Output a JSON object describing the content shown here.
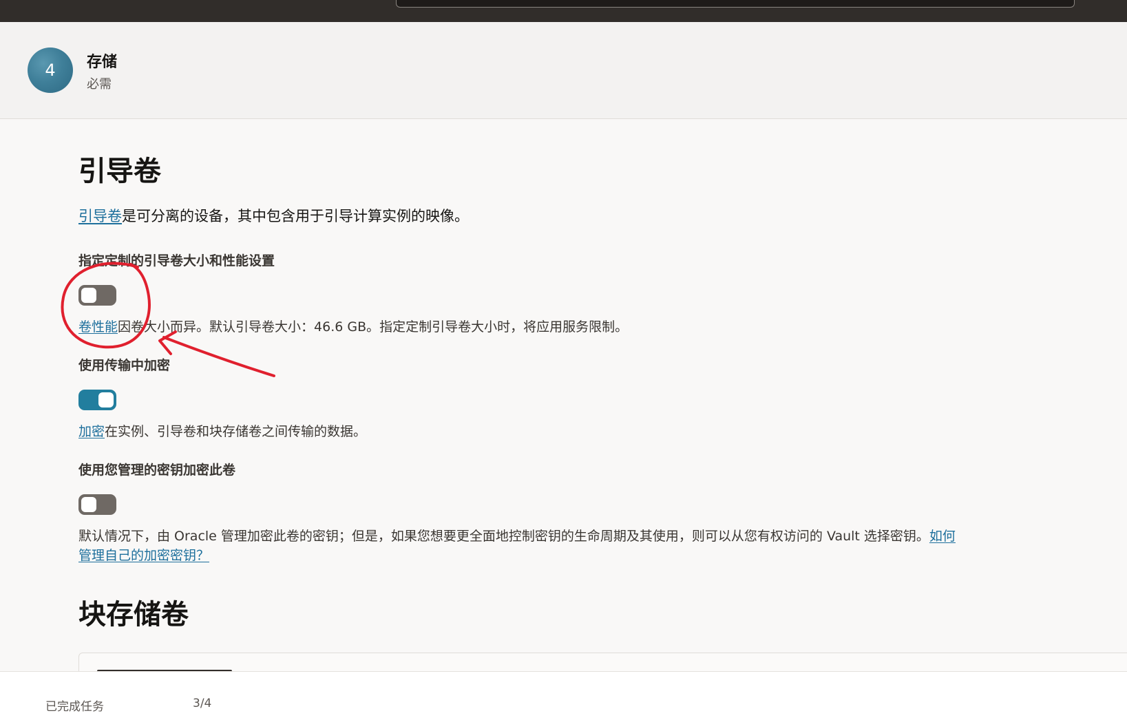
{
  "step": {
    "number": "4",
    "title": "存储",
    "subtitle": "必需"
  },
  "boot_volume": {
    "heading": "引导卷",
    "intro_link": "引导卷",
    "intro_text": "是可分离的设备，其中包含用于引导计算实例的映像。",
    "custom_size": {
      "label": "指定定制的引导卷大小和性能设置",
      "enabled": false,
      "help_link": "卷性能",
      "help_text": "因卷大小而异。默认引导卷大小：46.6 GB。指定定制引导卷大小时，将应用服务限制。"
    },
    "in_transit": {
      "label": "使用传输中加密",
      "enabled": true,
      "help_link": "加密",
      "help_text": "在实例、引导卷和块存储卷之间传输的数据。"
    },
    "own_key": {
      "label": "使用您管理的密钥加密此卷",
      "enabled": false,
      "help_text": "默认情况下，由 Oracle 管理加密此卷的密钥；但是，如果您想要更全面地控制密钥的生命周期及其使用，则可以从您有权访问的 Vault 选择密钥。",
      "help_link_1": "如何",
      "help_link_2": "管理自己的加密密钥？"
    }
  },
  "block_volume": {
    "heading": "块存储卷"
  },
  "footer": {
    "label": "已完成任务",
    "count": "3/4"
  },
  "colors": {
    "accent": "#227e9e",
    "link": "#1d6f9c",
    "annotation": "#e0202e"
  }
}
